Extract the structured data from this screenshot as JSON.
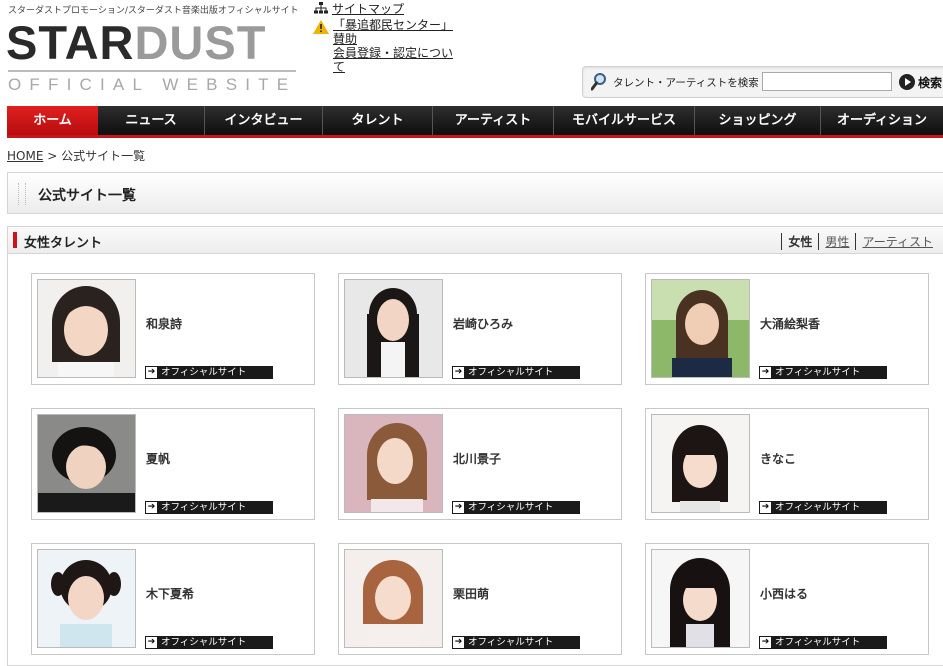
{
  "header": {
    "tagline": "スターダストプロモーション/スターダスト音楽出版オフィシャルサイト",
    "logo_star": "STAR",
    "logo_dust": "DUST",
    "logo_sub": "OFFICIAL WEBSITE",
    "sitemap_label": "サイトマップ",
    "notice_links": [
      "「暴追都民センター」賛助",
      "会員登録・認定について"
    ],
    "search_label": "タレント・アーティストを検索",
    "search_value": "",
    "search_button": "検索"
  },
  "nav": {
    "items": [
      {
        "label": "ホーム",
        "active": true
      },
      {
        "label": "ニュース",
        "active": false
      },
      {
        "label": "インタビュー",
        "active": false
      },
      {
        "label": "タレント",
        "active": false
      },
      {
        "label": "アーティスト",
        "active": false
      },
      {
        "label": "モバイルサービス",
        "active": false
      },
      {
        "label": "ショッピング",
        "active": false
      },
      {
        "label": "オーディション",
        "active": false
      }
    ]
  },
  "breadcrumb": {
    "home": "HOME",
    "separator": " > ",
    "current": "公式サイト一覧"
  },
  "page_title": "公式サイト一覧",
  "section": {
    "title": "女性タレント",
    "filters": [
      {
        "label": "女性",
        "current": true
      },
      {
        "label": "男性",
        "current": false
      },
      {
        "label": "アーティスト",
        "current": false
      }
    ]
  },
  "talents": [
    {
      "name": "和泉詩",
      "link": "オフィシャルサイト"
    },
    {
      "name": "岩崎ひろみ",
      "link": "オフィシャルサイト"
    },
    {
      "name": "大涌絵梨香",
      "link": "オフィシャルサイト"
    },
    {
      "name": "夏帆",
      "link": "オフィシャルサイト"
    },
    {
      "name": "北川景子",
      "link": "オフィシャルサイト"
    },
    {
      "name": "きなこ",
      "link": "オフィシャルサイト"
    },
    {
      "name": "木下夏希",
      "link": "オフィシャルサイト"
    },
    {
      "name": "栗田萌",
      "link": "オフィシャルサイト"
    },
    {
      "name": "小西はる",
      "link": "オフィシャルサイト"
    }
  ],
  "colors": {
    "accent_red": "#c9161a",
    "nav_dark": "#1a1a1a"
  }
}
